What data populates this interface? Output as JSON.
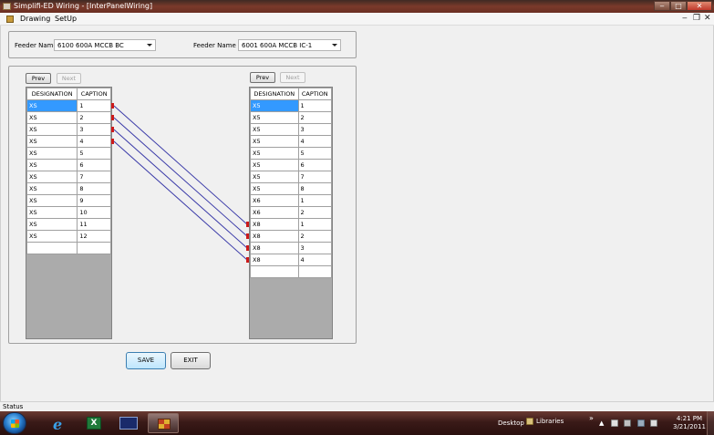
{
  "window": {
    "title": "Simplifi-ED Wiring - [InterPanelWiring]",
    "min_glyph": "‒",
    "max_glyph": "□",
    "close_glyph": "✕"
  },
  "menu": {
    "items": [
      "Drawing",
      "SetUp"
    ],
    "mdi_min": "‒",
    "mdi_restore": "❐",
    "mdi_close": "✕"
  },
  "feeder": {
    "left_label": "Feeder Name",
    "left_value": "6100 600A MCCB BC",
    "right_label": "Feeder Name",
    "right_value": "6001 600A MCCB IC-1"
  },
  "left_panel": {
    "prev": "Prev",
    "next": "Next",
    "headers": [
      "DESIGNATION",
      "CAPTION"
    ],
    "rows": [
      [
        "XS",
        "1"
      ],
      [
        "XS",
        "2"
      ],
      [
        "XS",
        "3"
      ],
      [
        "XS",
        "4"
      ],
      [
        "XS",
        "5"
      ],
      [
        "XS",
        "6"
      ],
      [
        "XS",
        "7"
      ],
      [
        "XS",
        "8"
      ],
      [
        "XS",
        "9"
      ],
      [
        "XS",
        "10"
      ],
      [
        "XS",
        "11"
      ],
      [
        "XS",
        "12"
      ],
      [
        "",
        ""
      ]
    ],
    "selected_row": 0
  },
  "right_panel": {
    "prev": "Prev",
    "next": "Next",
    "headers": [
      "DESIGNATION",
      "CAPTION"
    ],
    "rows": [
      [
        "X5",
        "1"
      ],
      [
        "X5",
        "2"
      ],
      [
        "X5",
        "3"
      ],
      [
        "X5",
        "4"
      ],
      [
        "X5",
        "5"
      ],
      [
        "X5",
        "6"
      ],
      [
        "X5",
        "7"
      ],
      [
        "X5",
        "8"
      ],
      [
        "X6",
        "1"
      ],
      [
        "X6",
        "2"
      ],
      [
        "X8",
        "1"
      ],
      [
        "X8",
        "2"
      ],
      [
        "X8",
        "3"
      ],
      [
        "X8",
        "4"
      ],
      [
        "",
        ""
      ]
    ],
    "selected_row": 0
  },
  "connections": [
    {
      "from_row": 0,
      "to_row": 10
    },
    {
      "from_row": 1,
      "to_row": 11
    },
    {
      "from_row": 2,
      "to_row": 12
    },
    {
      "from_row": 3,
      "to_row": 13
    }
  ],
  "colors": {
    "wire": "#3a3aa8",
    "terminal": "#cc1a1a",
    "selection": "#3399ff"
  },
  "buttons": {
    "save": "SAVE",
    "exit": "EXIT"
  },
  "status": {
    "text": "Status"
  },
  "taskbar": {
    "pinned": [
      "internet-explorer-icon",
      "excel-icon",
      "window-icon",
      "app-icon"
    ],
    "desktop": "Desktop",
    "libraries": "Libraries",
    "chevron": "»",
    "time": "4:21 PM",
    "date": "3/21/2011"
  }
}
